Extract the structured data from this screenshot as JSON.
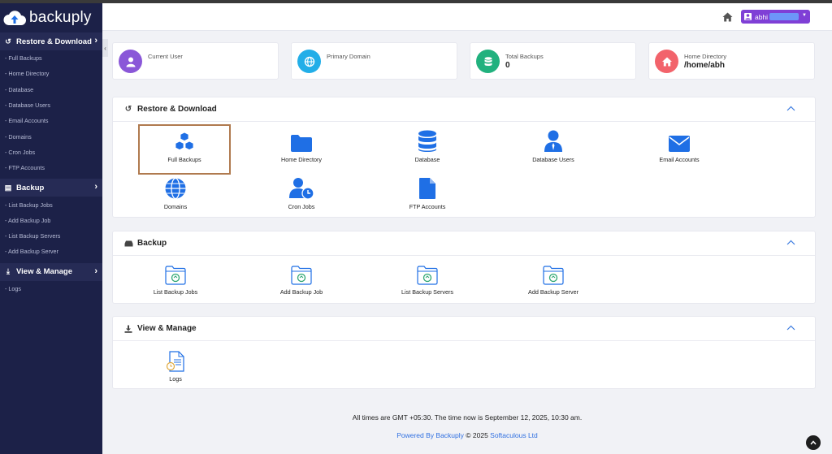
{
  "app": {
    "brand": "backuply"
  },
  "sidebar": {
    "sections": [
      {
        "title": "Restore & Download",
        "items": [
          "- Full Backups",
          "- Home Directory",
          "- Database",
          "- Database Users",
          "- Email Accounts",
          "- Domains",
          "- Cron Jobs",
          "- FTP Accounts"
        ]
      },
      {
        "title": "Backup",
        "items": [
          "- List Backup Jobs",
          "- Add Backup Job",
          "- List Backup Servers",
          "- Add Backup Server"
        ]
      },
      {
        "title": "View & Manage",
        "items": [
          "- Logs"
        ]
      }
    ]
  },
  "header": {
    "user": "abhi"
  },
  "stats": [
    {
      "label": "Current User",
      "value": "",
      "color": "#8a57d8",
      "icon": "user-icon"
    },
    {
      "label": "Primary Domain",
      "value": "",
      "color": "#22aee8",
      "icon": "globe-icon"
    },
    {
      "label": "Total Backups",
      "value": "0",
      "color": "#21b17e",
      "icon": "database-icon"
    },
    {
      "label": "Home Directory",
      "value": "/home/abh",
      "color": "#f2636b",
      "icon": "home-icon"
    }
  ],
  "panels": {
    "restore": {
      "title": "Restore & Download",
      "tiles": [
        "Full Backups",
        "Home Directory",
        "Database",
        "Database Users",
        "Email Accounts",
        "Domains",
        "Cron Jobs",
        "FTP Accounts"
      ]
    },
    "backup": {
      "title": "Backup",
      "tiles": [
        "List Backup Jobs",
        "Add Backup Job",
        "List Backup Servers",
        "Add Backup Server"
      ]
    },
    "manage": {
      "title": "View & Manage",
      "tiles": [
        "Logs"
      ]
    }
  },
  "footer": {
    "time_text": "All times are GMT +05:30. The time now is September 12, 2025, 10:30 am.",
    "powered_by": "Powered By Backuply",
    "copyright": " © 2025 ",
    "company": "Softaculous Ltd"
  },
  "colors": {
    "accent": "#1f6fe5",
    "sidebar": "#1c2148",
    "user_button": "#7f3fd6",
    "selected_outline": "#b07a4f"
  }
}
